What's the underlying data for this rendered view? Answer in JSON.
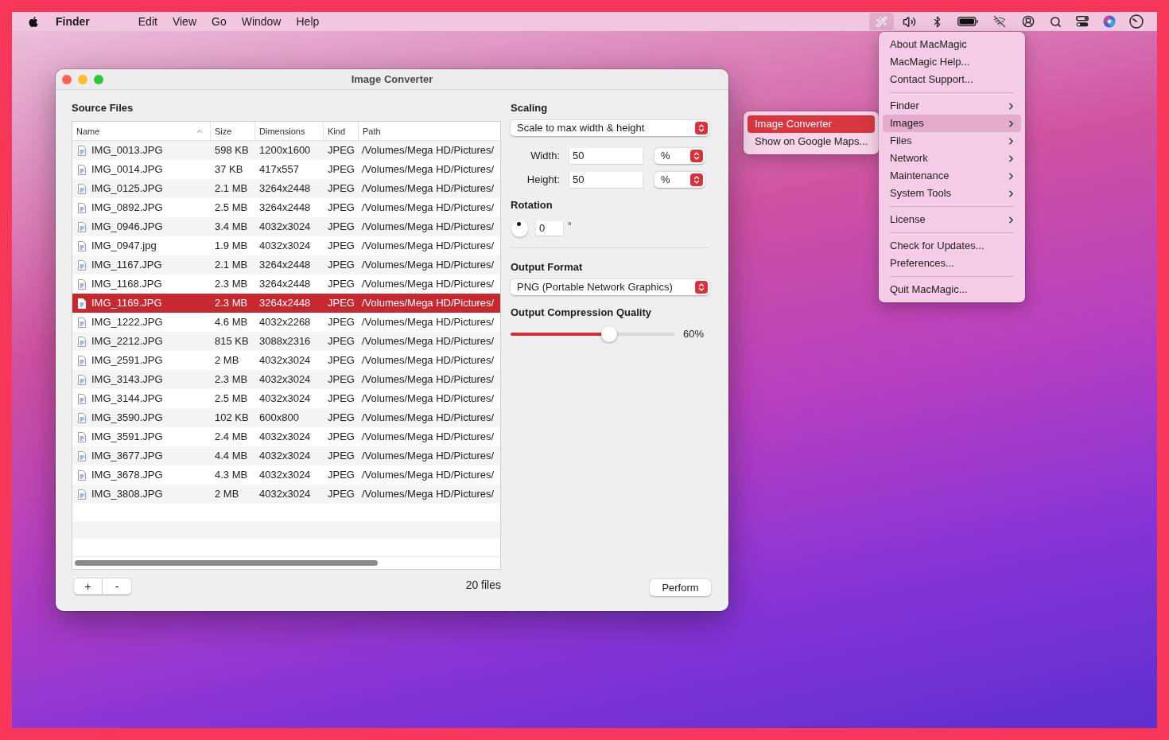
{
  "menu_bar": {
    "app_name": "Finder",
    "menus": [
      "Edit",
      "View",
      "Go",
      "Window",
      "Help"
    ],
    "status_item": {
      "selected": true
    }
  },
  "app_menu": {
    "items": [
      {
        "kind": "item",
        "label": "About MacMagic",
        "selected": false
      },
      {
        "kind": "item",
        "label": "MacMagic Help...",
        "selected": false
      },
      {
        "kind": "item",
        "label": "Contact Support...",
        "selected": false
      },
      {
        "kind": "separator"
      },
      {
        "kind": "submenu",
        "label": "Finder",
        "selected": false
      },
      {
        "kind": "submenu",
        "label": "Images",
        "selected": true
      },
      {
        "kind": "submenu",
        "label": "Files",
        "selected": false
      },
      {
        "kind": "submenu",
        "label": "Network",
        "selected": false
      },
      {
        "kind": "submenu",
        "label": "Maintenance",
        "selected": false
      },
      {
        "kind": "submenu",
        "label": "System Tools",
        "selected": false
      },
      {
        "kind": "separator"
      },
      {
        "kind": "submenu",
        "label": "License",
        "selected": false
      },
      {
        "kind": "separator"
      },
      {
        "kind": "item",
        "label": "Check for Updates...",
        "selected": false
      },
      {
        "kind": "item",
        "label": "Preferences...",
        "selected": false
      },
      {
        "kind": "separator"
      },
      {
        "kind": "item",
        "label": "Quit MacMagic...",
        "selected": false
      }
    ]
  },
  "submenu": {
    "items": [
      {
        "label": "Image Converter",
        "selected": true
      },
      {
        "label": "Show on Google Maps...",
        "selected": false
      }
    ]
  },
  "window": {
    "title": "Image Converter",
    "source_files": {
      "heading": "Source Files",
      "columns": [
        {
          "label": "Name",
          "sorted": true
        },
        {
          "label": "Size",
          "sorted": false
        },
        {
          "label": "Dimensions",
          "sorted": false
        },
        {
          "label": "Kind",
          "sorted": false
        },
        {
          "label": "Path",
          "sorted": false
        }
      ],
      "rows": [
        {
          "name": "IMG_0013.JPG",
          "size": "598 KB",
          "dimensions": "1200x1600",
          "file_kind": "JPEG",
          "path": "/Volumes/Mega HD/Pictures/",
          "selected": false
        },
        {
          "name": "IMG_0014.JPG",
          "size": "37 KB",
          "dimensions": "417x557",
          "file_kind": "JPEG",
          "path": "/Volumes/Mega HD/Pictures/",
          "selected": false
        },
        {
          "name": "IMG_0125.JPG",
          "size": "2.1 MB",
          "dimensions": "3264x2448",
          "file_kind": "JPEG",
          "path": "/Volumes/Mega HD/Pictures/",
          "selected": false
        },
        {
          "name": "IMG_0892.JPG",
          "size": "2.5 MB",
          "dimensions": "3264x2448",
          "file_kind": "JPEG",
          "path": "/Volumes/Mega HD/Pictures/",
          "selected": false
        },
        {
          "name": "IMG_0946.JPG",
          "size": "3.4 MB",
          "dimensions": "4032x3024",
          "file_kind": "JPEG",
          "path": "/Volumes/Mega HD/Pictures/",
          "selected": false
        },
        {
          "name": "IMG_0947.jpg",
          "size": "1.9 MB",
          "dimensions": "4032x3024",
          "file_kind": "JPEG",
          "path": "/Volumes/Mega HD/Pictures/",
          "selected": false
        },
        {
          "name": "IMG_1167.JPG",
          "size": "2.1 MB",
          "dimensions": "3264x2448",
          "file_kind": "JPEG",
          "path": "/Volumes/Mega HD/Pictures/",
          "selected": false
        },
        {
          "name": "IMG_1168.JPG",
          "size": "2.3 MB",
          "dimensions": "3264x2448",
          "file_kind": "JPEG",
          "path": "/Volumes/Mega HD/Pictures/",
          "selected": false
        },
        {
          "name": "IMG_1169.JPG",
          "size": "2.3 MB",
          "dimensions": "3264x2448",
          "file_kind": "JPEG",
          "path": "/Volumes/Mega HD/Pictures/",
          "selected": true
        },
        {
          "name": "IMG_1222.JPG",
          "size": "4.6 MB",
          "dimensions": "4032x2268",
          "file_kind": "JPEG",
          "path": "/Volumes/Mega HD/Pictures/",
          "selected": false
        },
        {
          "name": "IMG_2212.JPG",
          "size": "815 KB",
          "dimensions": "3088x2316",
          "file_kind": "JPEG",
          "path": "/Volumes/Mega HD/Pictures/",
          "selected": false
        },
        {
          "name": "IMG_2591.JPG",
          "size": "2 MB",
          "dimensions": "4032x3024",
          "file_kind": "JPEG",
          "path": "/Volumes/Mega HD/Pictures/",
          "selected": false
        },
        {
          "name": "IMG_3143.JPG",
          "size": "2.3 MB",
          "dimensions": "4032x3024",
          "file_kind": "JPEG",
          "path": "/Volumes/Mega HD/Pictures/",
          "selected": false
        },
        {
          "name": "IMG_3144.JPG",
          "size": "2.5 MB",
          "dimensions": "4032x3024",
          "file_kind": "JPEG",
          "path": "/Volumes/Mega HD/Pictures/",
          "selected": false
        },
        {
          "name": "IMG_3590.JPG",
          "size": "102 KB",
          "dimensions": "600x800",
          "file_kind": "JPEG",
          "path": "/Volumes/Mega HD/Pictures/",
          "selected": false
        },
        {
          "name": "IMG_3591.JPG",
          "size": "2.4 MB",
          "dimensions": "4032x3024",
          "file_kind": "JPEG",
          "path": "/Volumes/Mega HD/Pictures/",
          "selected": false
        },
        {
          "name": "IMG_3677.JPG",
          "size": "4.4 MB",
          "dimensions": "4032x3024",
          "file_kind": "JPEG",
          "path": "/Volumes/Mega HD/Pictures/",
          "selected": false
        },
        {
          "name": "IMG_3678.JPG",
          "size": "4.3 MB",
          "dimensions": "4032x3024",
          "file_kind": "JPEG",
          "path": "/Volumes/Mega HD/Pictures/",
          "selected": false
        },
        {
          "name": "IMG_3808.JPG",
          "size": "2 MB",
          "dimensions": "4032x3024",
          "file_kind": "JPEG",
          "path": "/Volumes/Mega HD/Pictures/",
          "selected": false
        }
      ],
      "add_button": "+",
      "remove_button": "-",
      "file_count": "20 files"
    },
    "scaling": {
      "heading": "Scaling",
      "mode": "Scale to max width & height",
      "width_label": "Width:",
      "width_value": "50",
      "width_unit": "%",
      "height_label": "Height:",
      "height_value": "50",
      "height_unit": "%"
    },
    "rotation": {
      "heading": "Rotation",
      "value": "0",
      "unit": "°"
    },
    "output_format": {
      "heading": "Output Format",
      "value": "PNG (Portable Network Graphics)"
    },
    "quality": {
      "heading": "Output Compression Quality",
      "level": 0.6,
      "reading": "60%"
    },
    "perform_button": "Perform"
  }
}
